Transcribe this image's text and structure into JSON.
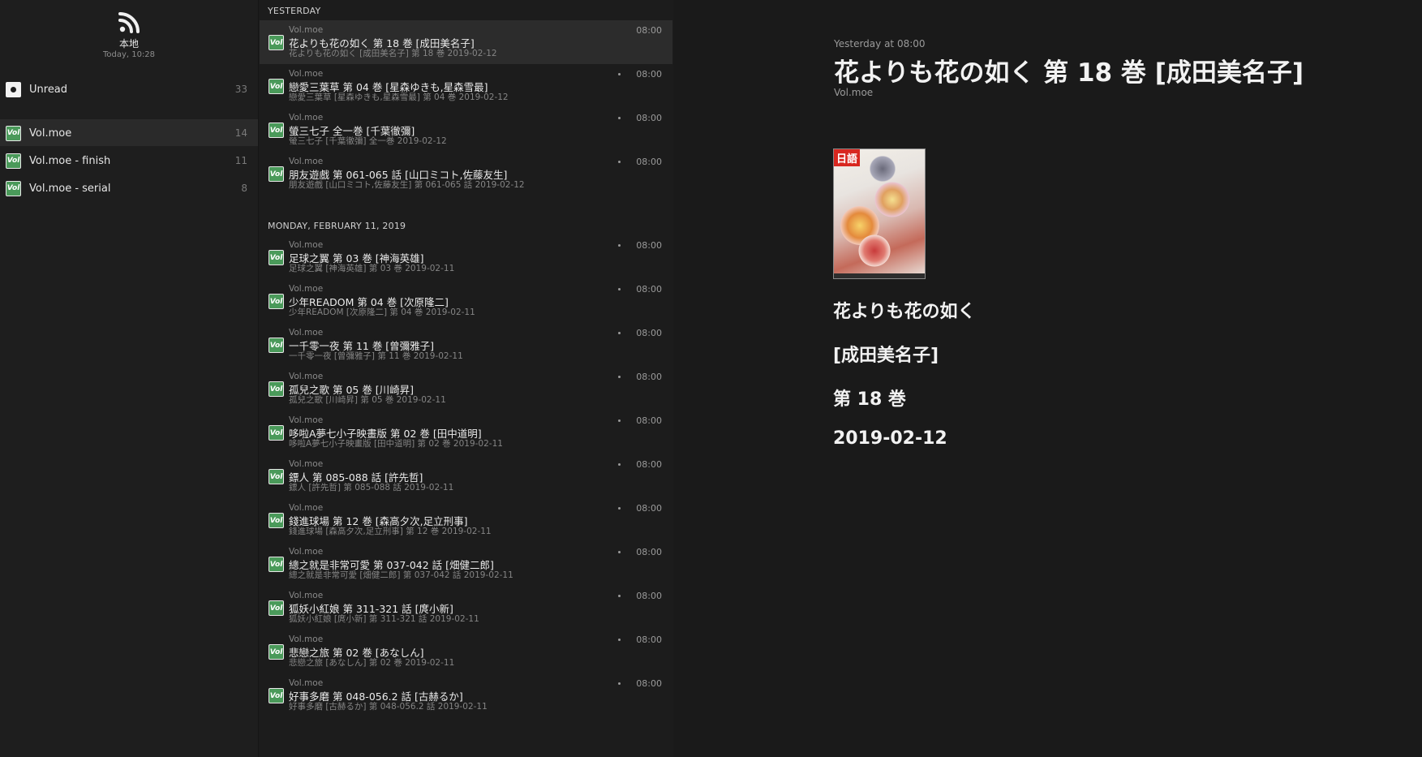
{
  "sidebar": {
    "account": {
      "name": "本地",
      "sub": "Today, 10:28",
      "icon": "rss-icon"
    },
    "unread": {
      "label": "Unread",
      "count": "33"
    },
    "feeds": [
      {
        "label": "Vol.moe",
        "count": "14",
        "selected": true
      },
      {
        "label": "Vol.moe - finish",
        "count": "11"
      },
      {
        "label": "Vol.moe - serial",
        "count": "8"
      }
    ],
    "feed_icon_text": "Vol"
  },
  "list": {
    "sections": [
      {
        "heading": "YESTERDAY"
      },
      {
        "heading": "MONDAY, FEBRUARY 11, 2019"
      }
    ],
    "items": [
      {
        "source": "Vol.moe",
        "title": "花よりも花の如く 第 18 巻 [成田美名子]",
        "summary": "花よりも花の如く [成田美名子] 第 18 巻 2019-02-12",
        "time": "08:00",
        "selected": true
      },
      {
        "source": "Vol.moe",
        "title": "戀愛三葉草 第 04 巻 [星森ゆきも,星森雪最]",
        "summary": "戀愛三葉草 [星森ゆきも,星森雪最] 第 04 巻 2019-02-12",
        "time": "08:00"
      },
      {
        "source": "Vol.moe",
        "title": "螢三七子 全一巻 [千葉徹彌]",
        "summary": "螢三七子 [千葉徹彌] 全一巻 2019-02-12",
        "time": "08:00"
      },
      {
        "source": "Vol.moe",
        "title": "朋友遊戲 第 061-065 話 [山口ミコト,佐藤友生]",
        "summary": "朋友遊戲 [山口ミコト,佐藤友生] 第 061-065 話 2019-02-12",
        "time": "08:00"
      },
      {
        "source": "Vol.moe",
        "title": "足球之翼 第 03 巻 [神海英雄]",
        "summary": "足球之翼 [神海英雄] 第 03 巻 2019-02-11",
        "time": "08:00"
      },
      {
        "source": "Vol.moe",
        "title": "少年READOM 第 04 巻 [次原隆二]",
        "summary": "少年READOM [次原隆二] 第 04 巻 2019-02-11",
        "time": "08:00"
      },
      {
        "source": "Vol.moe",
        "title": "一千零一夜 第 11 巻 [曾彌雅子]",
        "summary": "一千零一夜 [曾彌雅子] 第 11 巻 2019-02-11",
        "time": "08:00"
      },
      {
        "source": "Vol.moe",
        "title": "孤兒之歌 第 05 巻 [川崎昇]",
        "summary": "孤兒之歌 [川崎昇] 第 05 巻 2019-02-11",
        "time": "08:00"
      },
      {
        "source": "Vol.moe",
        "title": "哆啦A夢七小子映畫版 第 02 巻 [田中道明]",
        "summary": "哆啦A夢七小子映畫版 [田中道明] 第 02 巻 2019-02-11",
        "time": "08:00"
      },
      {
        "source": "Vol.moe",
        "title": "鏢人 第 085-088 話 [許先哲]",
        "summary": "鏢人 [許先哲] 第 085-088 話 2019-02-11",
        "time": "08:00"
      },
      {
        "source": "Vol.moe",
        "title": "錢進球場 第 12 巻 [森高夕次,足立刑事]",
        "summary": "錢進球場 [森高夕次,足立刑事] 第 12 巻 2019-02-11",
        "time": "08:00"
      },
      {
        "source": "Vol.moe",
        "title": "總之就是非常可愛 第 037-042 話 [畑健二郎]",
        "summary": "總之就是非常可愛 [畑健二郎] 第 037-042 話 2019-02-11",
        "time": "08:00"
      },
      {
        "source": "Vol.moe",
        "title": "狐妖小紅娘 第 311-321 話 [庹小新]",
        "summary": "狐妖小紅娘 [庹小新] 第 311-321 話 2019-02-11",
        "time": "08:00"
      },
      {
        "source": "Vol.moe",
        "title": "悲戀之旅 第 02 巻 [あなしん]",
        "summary": "悲戀之旅 [あなしん] 第 02 巻 2019-02-11",
        "time": "08:00"
      },
      {
        "source": "Vol.moe",
        "title": "好事多磨 第 048-056.2 話 [古赫るか]",
        "summary": "好事多磨 [古赫るか] 第 048-056.2 話 2019-02-11",
        "time": "08:00"
      }
    ]
  },
  "detail": {
    "date": "Yesterday at 08:00",
    "title": "花よりも花の如く 第 18 巻 [成田美名子]",
    "source": "Vol.moe",
    "cover_badge": "日語",
    "lines": [
      "花よりも花の如く",
      "[成田美名子]",
      "第 18 巻",
      "2019-02-12"
    ]
  },
  "colors": {
    "feed_icon": "#4a9a5a",
    "badge": "#d8271f",
    "background": "#1c1c1c"
  }
}
